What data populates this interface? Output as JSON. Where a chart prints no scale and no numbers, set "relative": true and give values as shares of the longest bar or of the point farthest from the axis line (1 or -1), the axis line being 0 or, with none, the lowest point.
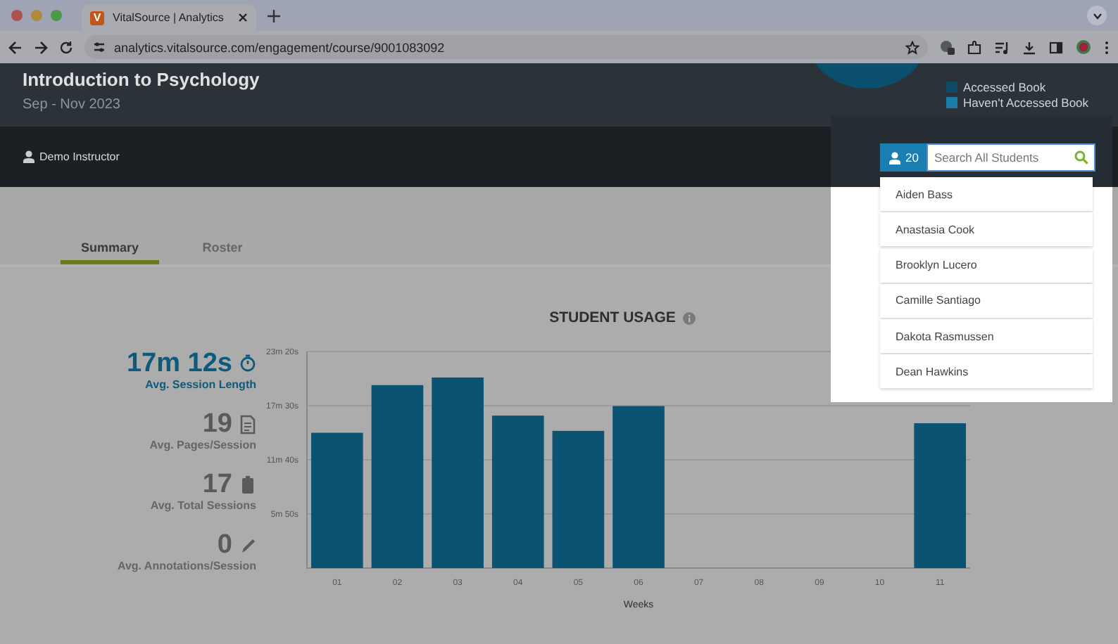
{
  "browser": {
    "tab_title": "VitalSource | Analytics",
    "favicon": "V",
    "url": "analytics.vitalsource.com/engagement/course/9001083092"
  },
  "header": {
    "title": "Introduction to Psychology",
    "dates": "Sep - Nov 2023",
    "legend": [
      {
        "label": "Accessed Book",
        "color": "#0d4a66"
      },
      {
        "label": "Haven't Accessed Book",
        "color": "#1a7ea6"
      }
    ]
  },
  "nav": {
    "user": "Demo Instructor",
    "student_count": "20",
    "search": {
      "placeholder": "Search All Students"
    },
    "suggestions": [
      "Aiden Bass",
      "Anastasia Cook",
      "Brooklyn Lucero",
      "Camille Santiago",
      "Dakota Rasmussen",
      "Dean Hawkins"
    ]
  },
  "tabs": [
    {
      "label": "Summary",
      "selected": true
    },
    {
      "label": "Roster",
      "selected": false
    }
  ],
  "stats": [
    {
      "value": "17m 12s",
      "label": "Avg. Session Length",
      "kind": "clock",
      "highlighted": true
    },
    {
      "value": "19",
      "label": "Avg. Pages/Session",
      "kind": "page",
      "highlighted": false
    },
    {
      "value": "17",
      "label": "Avg. Total Sessions",
      "kind": "battery",
      "highlighted": false
    },
    {
      "value": "0",
      "label": "Avg. Annotations/Session",
      "kind": "pencil",
      "highlighted": false
    }
  ],
  "usage": {
    "chart_data": {
      "type": "bar",
      "title": "STUDENT USAGE",
      "xlabel": "Weeks",
      "categories": [
        "01",
        "02",
        "03",
        "04",
        "05",
        "06",
        "07",
        "08",
        "09",
        "10",
        "11"
      ],
      "series": [
        {
          "color": "#0a5373",
          "values": [
            0.71,
            0.96,
            1,
            0.8,
            0.72,
            0.85,
            null,
            null,
            null,
            null,
            0.76
          ]
        }
      ],
      "relative": true
    },
    "y_axis_labels": [
      "23m 20s",
      "17m 30s",
      "11m 40s",
      "5m 50s"
    ]
  }
}
